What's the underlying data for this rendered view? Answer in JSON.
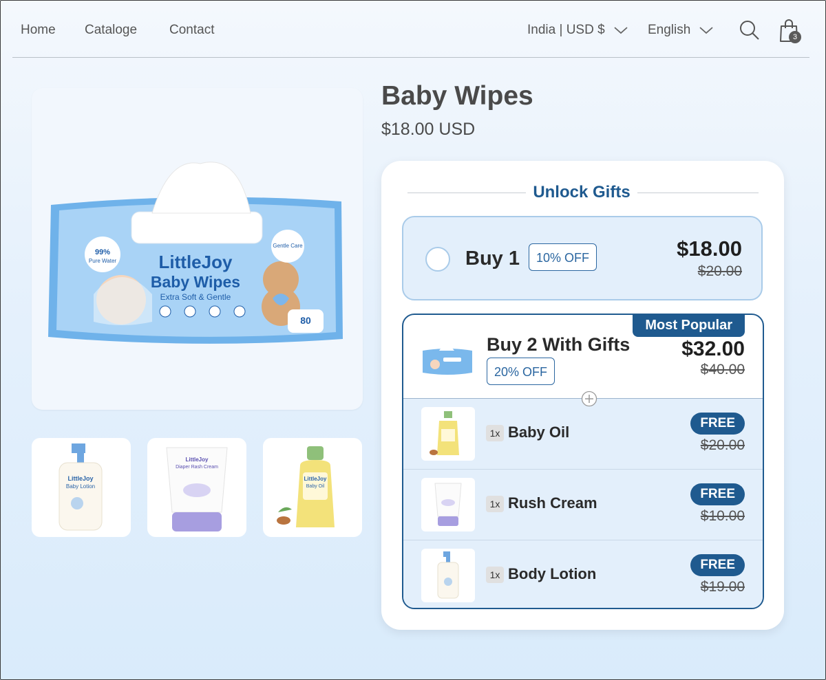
{
  "nav": {
    "home": "Home",
    "catalog": "Cataloge",
    "contact": "Contact",
    "region": "India | USD $",
    "language": "English",
    "cart_count": "3"
  },
  "product": {
    "title": "Baby Wipes",
    "price": "$18.00 USD"
  },
  "offers": {
    "heading": "Unlock Gifts",
    "option1": {
      "label": "Buy 1",
      "badge": "10% OFF",
      "price": "$18.00",
      "old_price": "$20.00"
    },
    "option2": {
      "ribbon": "Most Popular",
      "label": "Buy 2 With Gifts",
      "badge": "20% OFF",
      "price": "$32.00",
      "old_price": "$40.00",
      "gifts": [
        {
          "qty": "1x",
          "name": "Baby Oil",
          "tag": "FREE",
          "old_price": "$20.00"
        },
        {
          "qty": "1x",
          "name": "Rush Cream",
          "tag": "FREE",
          "old_price": "$10.00"
        },
        {
          "qty": "1x",
          "name": "Body Lotion",
          "tag": "FREE",
          "old_price": "$19.00"
        }
      ]
    }
  },
  "colors": {
    "brand": "#1f5a8f",
    "option_bg": "#e3effb",
    "option_border": "#a9cbe9"
  },
  "icons": [
    "chevron-down-icon",
    "search-icon",
    "shopping-bag-icon",
    "plus-circle-icon"
  ]
}
